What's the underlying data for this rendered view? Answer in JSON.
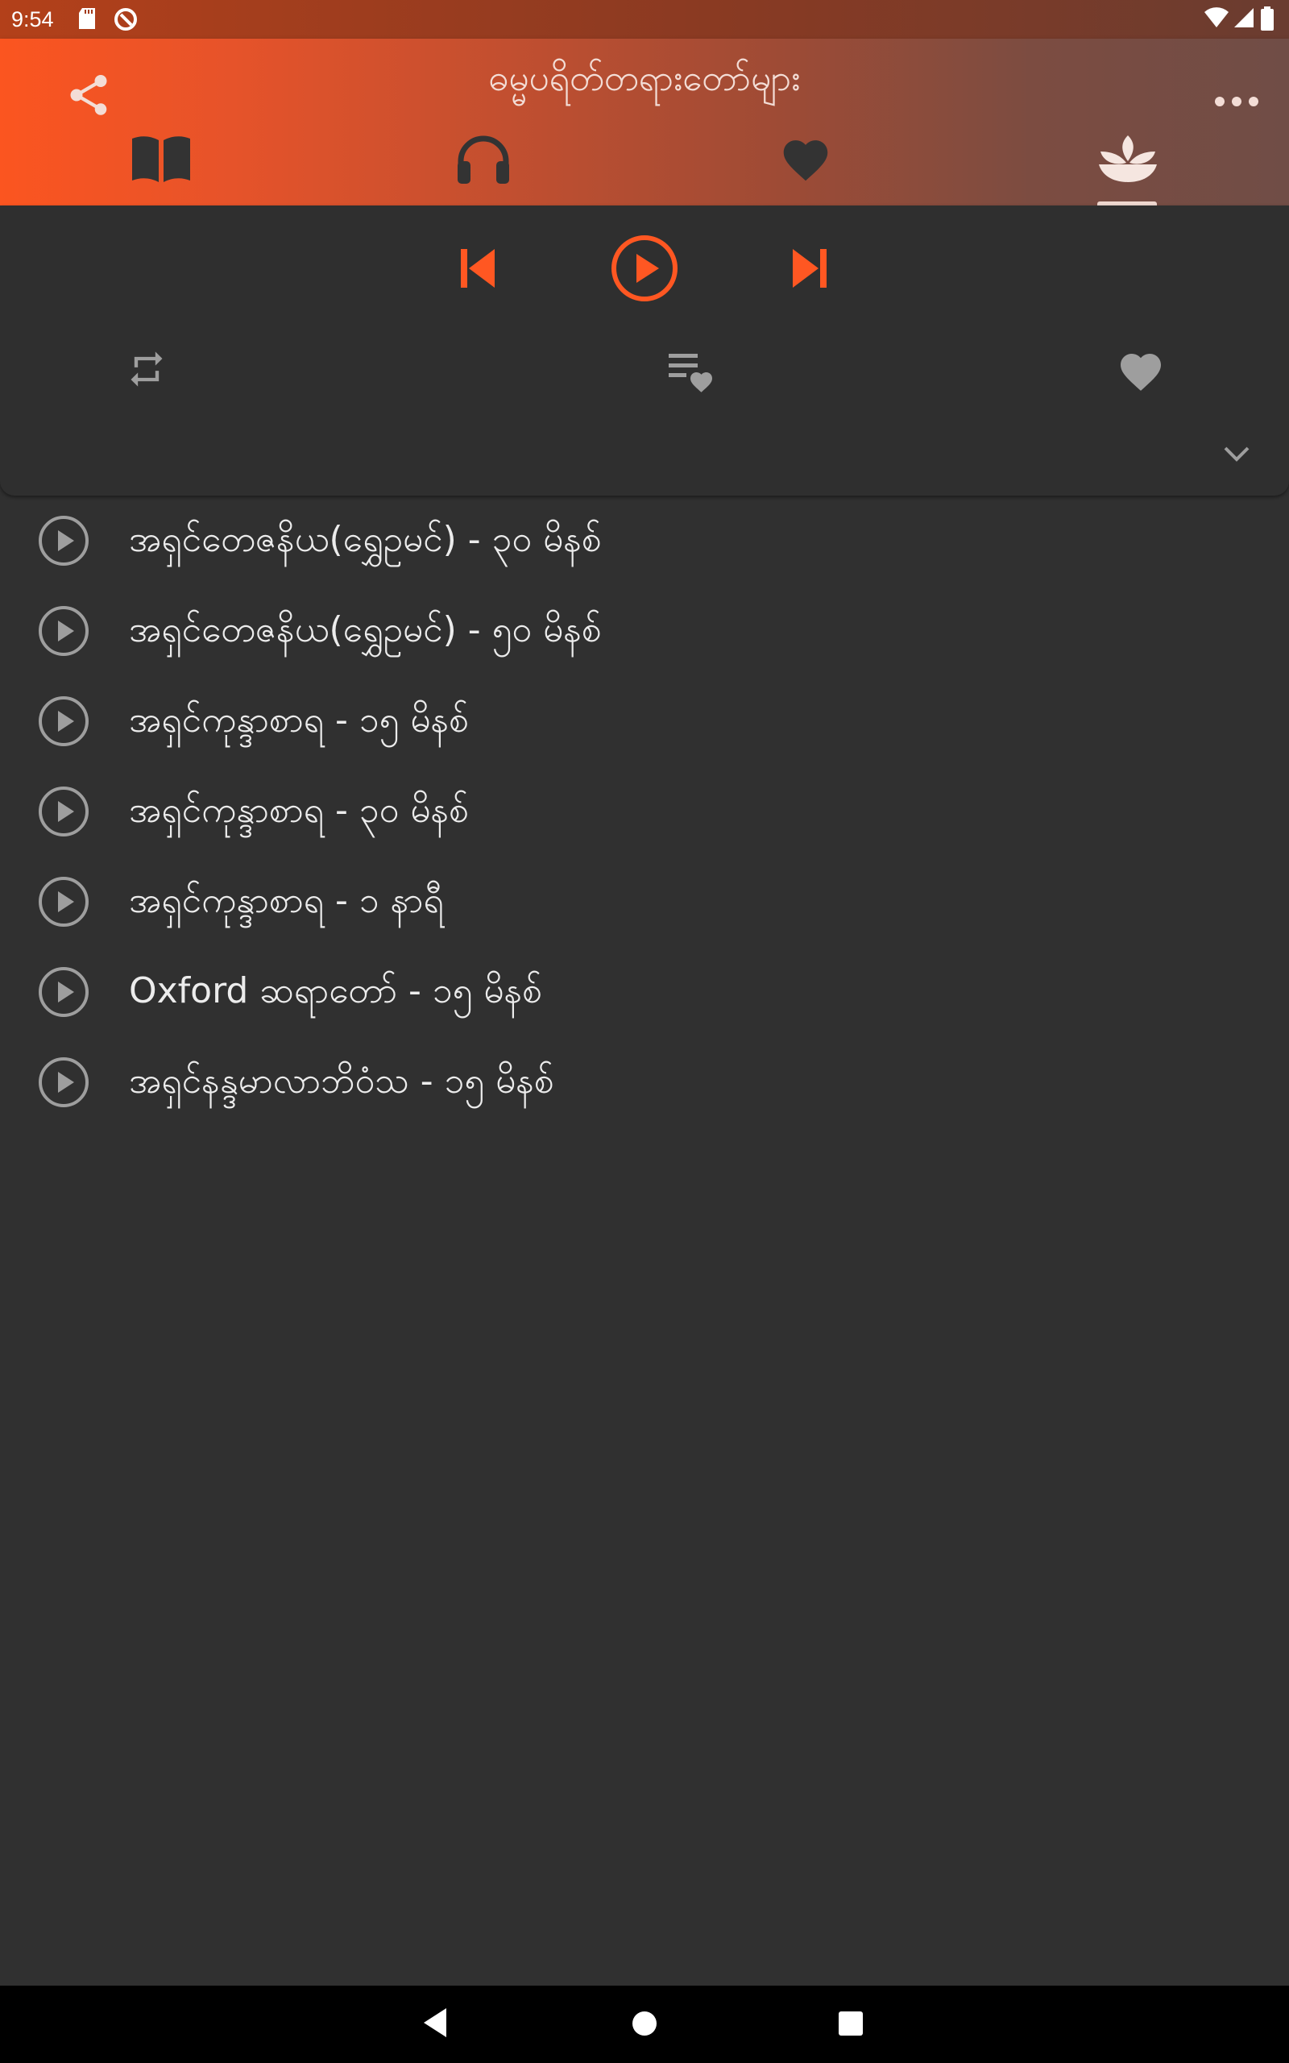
{
  "status_bar": {
    "time": "9:54"
  },
  "app_bar": {
    "title": "ဓမ္မပရိတ်တရားတော်များ",
    "tabs": [
      {
        "icon": "book-icon",
        "selected": false
      },
      {
        "icon": "headphones-icon",
        "selected": false
      },
      {
        "icon": "heart-icon",
        "selected": false
      },
      {
        "icon": "lotus-icon",
        "selected": true
      }
    ]
  },
  "player": {
    "controls": [
      "previous-icon",
      "play-icon",
      "next-icon"
    ],
    "secondary": [
      "repeat-icon",
      "playlist-favorite-icon",
      "favorite-icon"
    ],
    "accent_color": "#ff5722"
  },
  "tracks": [
    {
      "title": "အရှင်တေဇနိယ(ရွှေဥမင်) - ၃၀ မိနစ်"
    },
    {
      "title": "အရှင်တေဇနိယ(ရွှေဥမင်) - ၅၀ မိနစ်"
    },
    {
      "title": "အရှင်ကုန္ဒာစာရ - ၁၅ မိနစ်"
    },
    {
      "title": "အရှင်ကုန္ဒာစာရ - ၃၀ မိနစ်"
    },
    {
      "title": "အရှင်ကုန္ဒာစာရ - ၁ နာရီ"
    },
    {
      "title": "Oxford ဆရာတော် - ၁၅ မိနစ်"
    },
    {
      "title": "အရှင်နန္ဒမာလာဘိဝံသ - ၁၅ မိနစ်"
    }
  ]
}
